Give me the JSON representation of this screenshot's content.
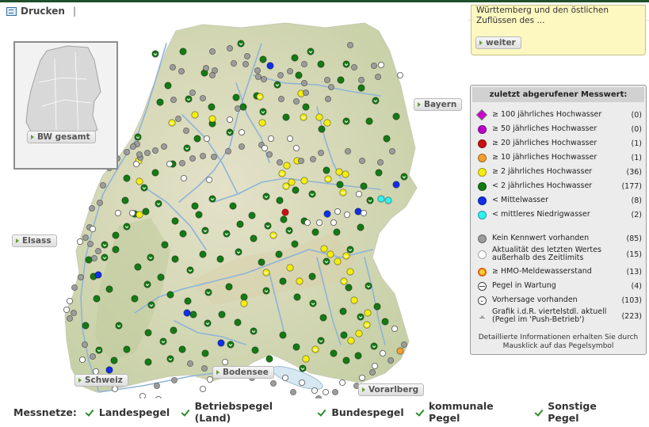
{
  "toolbar": {
    "print_label": "Drucken",
    "separator": "|"
  },
  "map": {
    "neighbors": {
      "bayern": "Bayern",
      "elsass": "Elsass",
      "schweiz": "Schweiz",
      "bodensee": "Bodensee",
      "vorarlberg": "Vorarlberg"
    },
    "overview_button": "BW gesamt",
    "stations": {
      "green": [
        [
          196,
          43
        ],
        [
          231,
          40
        ],
        [
          258,
          67
        ],
        [
          304,
          30
        ],
        [
          332,
          50
        ],
        [
          372,
          48
        ],
        [
          392,
          40
        ],
        [
          430,
          76
        ],
        [
          456,
          86
        ],
        [
          474,
          102
        ],
        [
          500,
          122
        ],
        [
          488,
          150
        ],
        [
          510,
          198
        ],
        [
          478,
          193
        ],
        [
          459,
          210
        ],
        [
          467,
          228
        ],
        [
          425,
          268
        ],
        [
          455,
          262
        ],
        [
          442,
          290
        ],
        [
          398,
          268
        ],
        [
          384,
          254
        ],
        [
          412,
          305
        ],
        [
          394,
          324
        ],
        [
          440,
          338
        ],
        [
          455,
          375
        ],
        [
          434,
          398
        ],
        [
          421,
          421
        ],
        [
          405,
          405
        ],
        [
          374,
          413
        ],
        [
          357,
          398
        ],
        [
          320,
          393
        ],
        [
          300,
          382
        ],
        [
          280,
          372
        ],
        [
          262,
          383
        ],
        [
          244,
          372
        ],
        [
          219,
          392
        ],
        [
          206,
          406
        ],
        [
          187,
          395
        ],
        [
          160,
          416
        ],
        [
          150,
          386
        ],
        [
          138,
          340
        ],
        [
          122,
          352
        ],
        [
          132,
          300
        ],
        [
          146,
          290
        ],
        [
          118,
          324
        ],
        [
          160,
          261
        ],
        [
          170,
          245
        ],
        [
          184,
          242
        ],
        [
          200,
          232
        ],
        [
          221,
          254
        ],
        [
          246,
          235
        ],
        [
          268,
          226
        ],
        [
          294,
          235
        ],
        [
          318,
          247
        ],
        [
          336,
          223
        ],
        [
          353,
          228
        ],
        [
          373,
          215
        ],
        [
          394,
          220
        ],
        [
          412,
          190
        ],
        [
          429,
          208
        ],
        [
          365,
          266
        ],
        [
          352,
          296
        ],
        [
          330,
          306
        ],
        [
          301,
          293
        ],
        [
          278,
          302
        ],
        [
          256,
          296
        ],
        [
          240,
          316
        ],
        [
          221,
          302
        ],
        [
          203,
          325
        ],
        [
          186,
          334
        ],
        [
          174,
          312
        ],
        [
          170,
          352
        ],
        [
          191,
          360
        ],
        [
          215,
          347
        ],
        [
          237,
          355
        ],
        [
          263,
          344
        ],
        [
          289,
          337
        ],
        [
          308,
          350
        ],
        [
          336,
          342
        ],
        [
          357,
          330
        ],
        [
          375,
          350
        ],
        [
          395,
          358
        ],
        [
          408,
          376
        ],
        [
          433,
          368
        ],
        [
          465,
          336
        ],
        [
          476,
          362
        ],
        [
          486,
          381
        ],
        [
          472,
          412
        ],
        [
          452,
          424
        ],
        [
          437,
          430
        ],
        [
          382,
          440
        ],
        [
          340,
          428
        ],
        [
          322,
          417
        ],
        [
          291,
          410
        ],
        [
          259,
          421
        ],
        [
          230,
          416
        ],
        [
          215,
          428
        ],
        [
          187,
          432
        ],
        [
          144,
          430
        ],
        [
          125,
          417
        ],
        [
          108,
          386
        ],
        [
          112,
          303
        ],
        [
          132,
          284
        ],
        [
          146,
          272
        ],
        [
          158,
          228
        ],
        [
          182,
          212
        ],
        [
          196,
          193
        ],
        [
          218,
          182
        ],
        [
          236,
          162
        ],
        [
          249,
          150
        ],
        [
          268,
          131
        ],
        [
          290,
          142
        ],
        [
          307,
          110
        ],
        [
          324,
          96
        ],
        [
          350,
          82
        ],
        [
          377,
          70
        ],
        [
          405,
          56
        ],
        [
          437,
          56
        ],
        [
          386,
          110
        ],
        [
          406,
          138
        ],
        [
          437,
          128
        ],
        [
          466,
          128
        ],
        [
          361,
          123
        ],
        [
          332,
          116
        ],
        [
          298,
          98
        ],
        [
          267,
          110
        ],
        [
          238,
          100
        ],
        [
          212,
          83
        ],
        [
          202,
          104
        ],
        [
          174,
          148
        ],
        [
          160,
          200
        ],
        [
          251,
          246
        ],
        [
          286,
          270
        ],
        [
          303,
          258
        ],
        [
          320,
          276
        ],
        [
          338,
          260
        ],
        [
          358,
          252
        ],
        [
          372,
          283
        ],
        [
          259,
          266
        ],
        [
          231,
          270
        ],
        [
          208,
          284
        ],
        [
          190,
          300
        ]
      ],
      "yellow": [
        [
          175,
          178
        ],
        [
          176,
          204
        ],
        [
          176,
          246
        ],
        [
          217,
          130
        ],
        [
          246,
          120
        ],
        [
          268,
          125
        ],
        [
          328,
          97
        ],
        [
          331,
          130
        ],
        [
          380,
          93
        ],
        [
          383,
          123
        ],
        [
          403,
          123
        ],
        [
          413,
          130
        ],
        [
          356,
          194
        ],
        [
          362,
          184
        ],
        [
          375,
          178
        ],
        [
          361,
          210
        ],
        [
          368,
          205
        ],
        [
          384,
          203
        ],
        [
          414,
          201
        ],
        [
          428,
          192
        ],
        [
          436,
          195
        ],
        [
          433,
          218
        ],
        [
          409,
          289
        ],
        [
          417,
          296
        ],
        [
          437,
          298
        ],
        [
          426,
          305
        ],
        [
          442,
          318
        ],
        [
          434,
          330
        ],
        [
          447,
          354
        ],
        [
          464,
          370
        ],
        [
          463,
          385
        ],
        [
          453,
          396
        ],
        [
          443,
          405
        ],
        [
          398,
          416
        ],
        [
          386,
          428
        ],
        [
          308,
          358
        ],
        [
          336,
          319
        ],
        [
          366,
          313
        ],
        [
          378,
          330
        ],
        [
          345,
          272
        ]
      ],
      "blue": [
        [
          341,
          58
        ],
        [
          413,
          245
        ],
        [
          452,
          242
        ],
        [
          124,
          322
        ],
        [
          236,
          370
        ],
        [
          279,
          408
        ],
        [
          138,
          442
        ],
        [
          500,
          208
        ]
      ],
      "cyan": [
        [
          481,
          226
        ],
        [
          490,
          228
        ]
      ],
      "red": [
        [
          360,
          243
        ]
      ],
      "orange": [
        [
          505,
          418
        ]
      ],
      "gray": [
        [
          218,
          60
        ],
        [
          229,
          65
        ],
        [
          260,
          61
        ],
        [
          290,
          36
        ],
        [
          295,
          55
        ],
        [
          310,
          56
        ],
        [
          312,
          46
        ],
        [
          325,
          64
        ],
        [
          326,
          72
        ],
        [
          333,
          75
        ],
        [
          354,
          70
        ],
        [
          366,
          65
        ],
        [
          384,
          56
        ],
        [
          442,
          32
        ],
        [
          472,
          58
        ],
        [
          477,
          72
        ],
        [
          447,
          60
        ],
        [
          456,
          76
        ],
        [
          418,
          85
        ],
        [
          414,
          100
        ],
        [
          413,
          76
        ],
        [
          384,
          80
        ],
        [
          386,
          92
        ],
        [
          374,
          103
        ],
        [
          355,
          100
        ],
        [
          300,
          112
        ],
        [
          271,
          64
        ],
        [
          268,
          70
        ],
        [
          268,
          40
        ],
        [
          256,
          99
        ],
        [
          243,
          92
        ],
        [
          219,
          101
        ],
        [
          225,
          125
        ],
        [
          235,
          140
        ],
        [
          207,
          160
        ],
        [
          196,
          165
        ],
        [
          186,
          168
        ],
        [
          177,
          174
        ],
        [
          173,
          157
        ],
        [
          160,
          167
        ],
        [
          148,
          175
        ],
        [
          138,
          187
        ],
        [
          130,
          209
        ],
        [
          126,
          231
        ],
        [
          116,
          238
        ],
        [
          113,
          262
        ],
        [
          108,
          275
        ],
        [
          114,
          283
        ],
        [
          124,
          292
        ],
        [
          119,
          301
        ],
        [
          102,
          325
        ],
        [
          94,
          338
        ],
        [
          93,
          370
        ],
        [
          88,
          377
        ],
        [
          107,
          410
        ],
        [
          117,
          425
        ],
        [
          115,
          452
        ],
        [
          123,
          456
        ],
        [
          198,
          462
        ],
        [
          220,
          455
        ],
        [
          240,
          434
        ],
        [
          258,
          440
        ],
        [
          300,
          446
        ],
        [
          318,
          452
        ],
        [
          345,
          459
        ],
        [
          370,
          470
        ],
        [
          402,
          478
        ],
        [
          423,
          470
        ],
        [
          450,
          462
        ],
        [
          470,
          445
        ],
        [
          493,
          430
        ],
        [
          510,
          410
        ],
        [
          495,
          166
        ],
        [
          480,
          180
        ],
        [
          457,
          178
        ],
        [
          439,
          166
        ],
        [
          405,
          168
        ],
        [
          395,
          176
        ],
        [
          380,
          178
        ],
        [
          353,
          180
        ],
        [
          340,
          170
        ],
        [
          330,
          158
        ],
        [
          305,
          160
        ],
        [
          288,
          166
        ],
        [
          270,
          173
        ],
        [
          256,
          172
        ],
        [
          243,
          175
        ],
        [
          230,
          181
        ],
        [
          176,
          170
        ],
        [
          168,
          160
        ]
      ],
      "white": [
        [
          481,
          57
        ],
        [
          505,
          70
        ],
        [
          453,
          220
        ],
        [
          459,
          244
        ],
        [
          438,
          246
        ],
        [
          388,
          256
        ],
        [
          403,
          256
        ],
        [
          421,
          256
        ],
        [
          426,
          242
        ],
        [
          374,
          162
        ],
        [
          366,
          150
        ],
        [
          342,
          150
        ],
        [
          334,
          162
        ],
        [
          305,
          142
        ],
        [
          290,
          126
        ],
        [
          261,
          150
        ],
        [
          264,
          202
        ],
        [
          232,
          200
        ],
        [
          214,
          182
        ],
        [
          172,
          182
        ],
        [
          167,
          244
        ],
        [
          149,
          244
        ],
        [
          117,
          264
        ],
        [
          101,
          280
        ],
        [
          88,
          355
        ],
        [
          84,
          366
        ],
        [
          104,
          429
        ],
        [
          121,
          444
        ],
        [
          145,
          466
        ],
        [
          180,
          475
        ],
        [
          200,
          479
        ],
        [
          256,
          466
        ],
        [
          265,
          454
        ],
        [
          284,
          432
        ],
        [
          339,
          446
        ],
        [
          360,
          452
        ],
        [
          381,
          458
        ],
        [
          397,
          468
        ],
        [
          411,
          470
        ],
        [
          432,
          458
        ],
        [
          457,
          452
        ],
        [
          473,
          437
        ],
        [
          483,
          421
        ],
        [
          498,
          390
        ]
      ]
    }
  },
  "info_box": {
    "line1": "Württemberg und den östlichen",
    "line2": "Zuflüssen des ...",
    "button": "weiter"
  },
  "legend": {
    "title": "zuletzt abgerufener Messwert:",
    "rows": [
      {
        "label": "≥ 100 jährliches Hochwasser",
        "count": "(0)",
        "symbol": "diamond",
        "color": "#cc00cc"
      },
      {
        "label": "≥ 50 jährliches Hochwasser",
        "count": "(0)",
        "symbol": "dot",
        "color": "#b800c8"
      },
      {
        "label": "≥ 20 jährliches Hochwasser",
        "count": "(1)",
        "symbol": "dot",
        "color": "#cc1010"
      },
      {
        "label": "≥ 10 jährliches Hochwasser",
        "count": "(1)",
        "symbol": "dot",
        "color": "#f0a030"
      },
      {
        "label": "≥ 2 jährliches Hochwasser",
        "count": "(36)",
        "symbol": "dot",
        "color": "#f4ee10"
      },
      {
        "label": "< 2 jährliches Hochwasser",
        "count": "(177)",
        "symbol": "dot",
        "color": "#157a15"
      },
      {
        "label": "< Mittelwasser",
        "count": "(8)",
        "symbol": "dot",
        "color": "#1030e8"
      },
      {
        "label": "< mittleres Niedrigwasser",
        "count": "(2)",
        "symbol": "dot",
        "color": "#30f0f0"
      },
      {
        "label": "Kein Kennwert vorhanden",
        "count": "(85)",
        "symbol": "dot",
        "color": "#9c9c9c"
      },
      {
        "label": "Aktualität des letzten Wertes außerhalb des Zeitlimits",
        "count": "(15)",
        "symbol": "dot",
        "color": "#ffffff"
      },
      {
        "label": "≥ HMO-Meldewasserstand",
        "count": "(13)",
        "symbol": "hmo",
        "color": "#e06010"
      },
      {
        "label": "Pegel in Wartung",
        "count": "(4)",
        "symbol": "maint",
        "color": "#ffffff"
      },
      {
        "label": "Vorhersage vorhanden",
        "count": "(103)",
        "symbol": "forecast",
        "color": "#ffffff"
      },
      {
        "label": "Grafik i.d.R. viertelstdl. aktuell (Pegel im 'Push-Betrieb')",
        "count": "(223)",
        "symbol": "push",
        "color": "#333333"
      }
    ],
    "footer": "Detaillierte Informationen erhalten Sie durch Mausklick auf das Pegelsymbol"
  },
  "networks": {
    "label": "Messnetze:",
    "items": [
      "Landespegel",
      "Betriebspegel (Land)",
      "Bundespegel",
      "kommunale Pegel",
      "Sonstige Pegel"
    ]
  }
}
